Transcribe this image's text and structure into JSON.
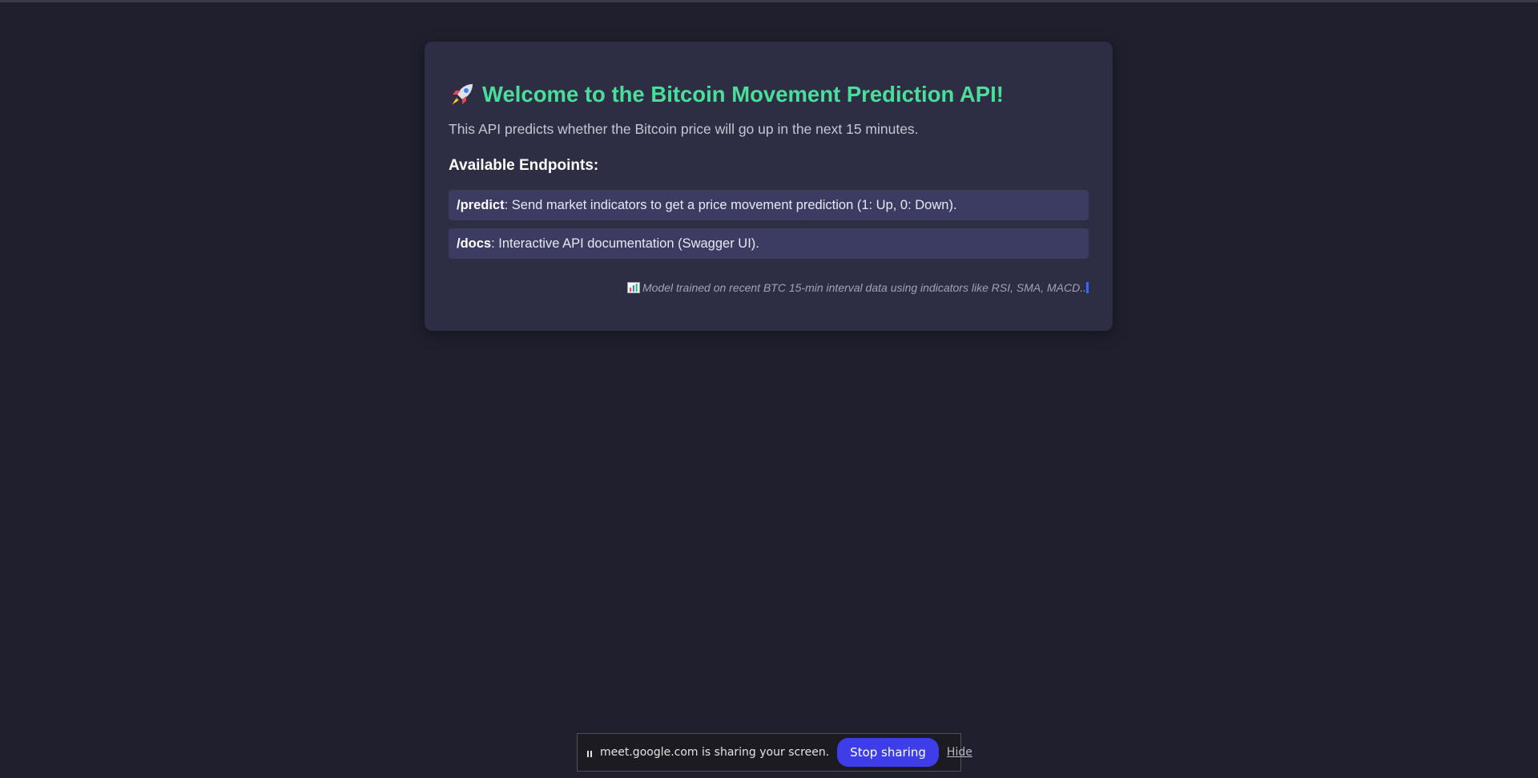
{
  "page": {
    "title": "Welcome to the Bitcoin Movement Prediction API!",
    "intro": "This API predicts whether the Bitcoin price will go up in the next 15 minutes.",
    "endpoints_heading": "Available Endpoints:",
    "endpoints": [
      {
        "path": "/predict",
        "description": ": Send market indicators to get a price movement prediction (1: Up, 0: Down)."
      },
      {
        "path": "/docs",
        "description": ": Interactive API documentation (Swagger UI)."
      }
    ],
    "footnote": "Model trained on recent BTC 15-min interval data using indicators like RSI, SMA, MACD.."
  },
  "icons": {
    "title_icon": "rocket-icon",
    "footnote_icon": "bar-chart-icon",
    "share_icon": "pause-icon"
  },
  "share_bar": {
    "message": "meet.google.com is sharing your screen.",
    "stop_label": "Stop sharing",
    "hide_label": "Hide"
  },
  "colors": {
    "background": "#1f1f2e",
    "card": "#2d2d44",
    "title": "#4ade9a",
    "endpoint_bg": "#3c3c62",
    "stop_button": "#3e3ee8"
  }
}
